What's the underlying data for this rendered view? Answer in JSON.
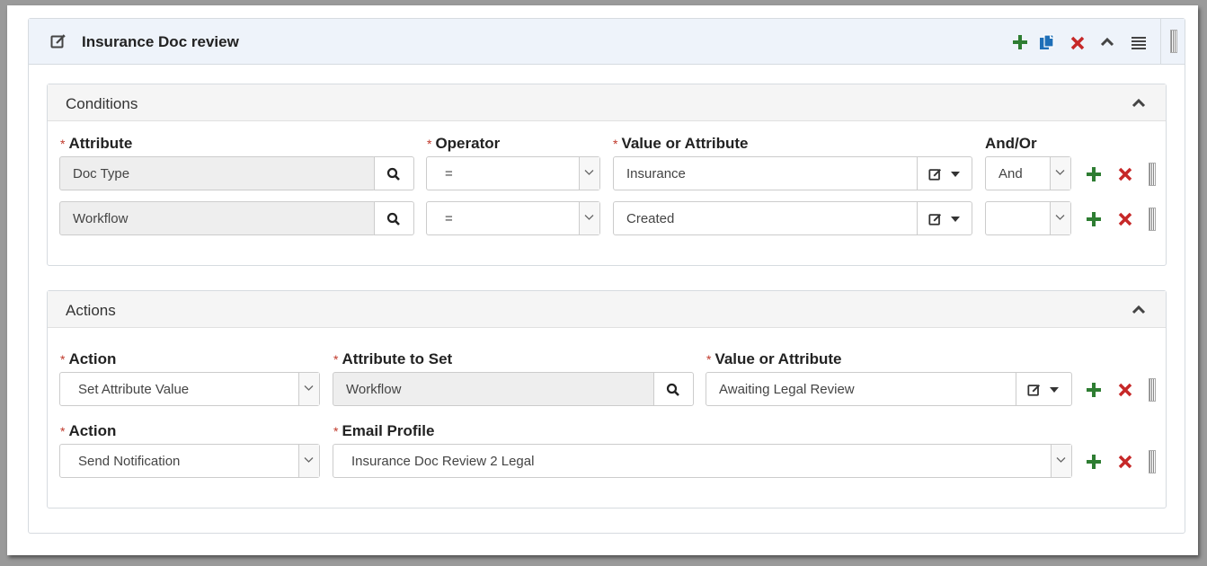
{
  "rule": {
    "title": "Insurance Doc review"
  },
  "conditions": {
    "title": "Conditions",
    "headers": {
      "attribute": "Attribute",
      "operator": "Operator",
      "value": "Value or Attribute",
      "andor": "And/Or"
    },
    "required_mark": "*",
    "rows": [
      {
        "attribute": "Doc Type",
        "operator": "=",
        "value": "Insurance",
        "andor": "And"
      },
      {
        "attribute": "Workflow",
        "operator": "=",
        "value": "Created",
        "andor": ""
      }
    ]
  },
  "actions": {
    "title": "Actions",
    "required_mark": "*",
    "row1": {
      "action_label": "Action",
      "action_value": "Set Attribute Value",
      "attr_label": "Attribute to Set",
      "attr_value": "Workflow",
      "value_label": "Value or Attribute",
      "value_value": "Awaiting Legal Review"
    },
    "row2": {
      "action_label": "Action",
      "action_value": "Send Notification",
      "profile_label": "Email Profile",
      "profile_value": "Insurance Doc Review 2 Legal"
    }
  },
  "colors": {
    "add": "#2e7d32",
    "delete": "#c62828",
    "copy": "#1e6fb8",
    "required": "#c0392b",
    "header_bg": "#eef3fa"
  },
  "icons": [
    "edit-icon",
    "plus-icon",
    "copy-icon",
    "close-icon",
    "chevron-up-icon",
    "menu-icon",
    "search-icon",
    "caret-down-icon",
    "drag-handle-icon"
  ]
}
